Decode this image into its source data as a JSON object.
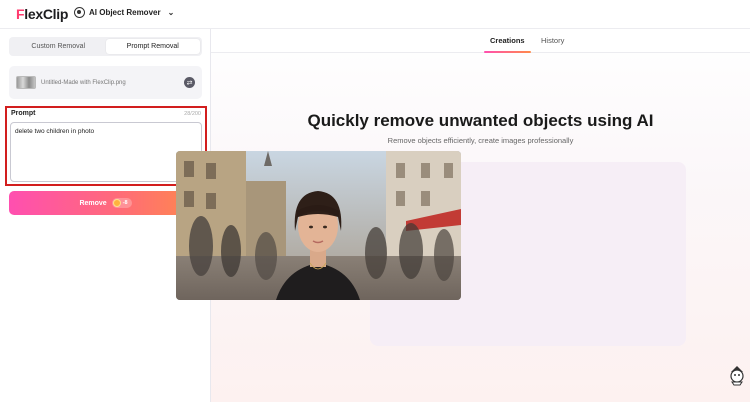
{
  "app": {
    "logo_prefix": "F",
    "logo_rest": "lexClip",
    "tool_name": "AI Object Remover",
    "tool_icon": "object-remover-icon",
    "chevron_icon": "chevron-down-icon"
  },
  "left_panel": {
    "mode_tabs": [
      {
        "label": "Custom Removal",
        "active": false
      },
      {
        "label": "Prompt Removal",
        "active": true
      }
    ],
    "file": {
      "name": "Untitled-Made with FlexClip.png",
      "thumb_icon": "image-thumbnail",
      "swap_icon": "swap-icon"
    },
    "prompt": {
      "label": "Prompt",
      "count": "28/200",
      "value": "delete two children in photo"
    },
    "remove_button": {
      "label": "Remove",
      "credits": "-8",
      "coin_icon": "coin-icon"
    }
  },
  "main": {
    "tabs": [
      {
        "label": "Creations",
        "active": true
      },
      {
        "label": "History",
        "active": false
      }
    ],
    "title": "Quickly remove unwanted objects using AI",
    "subtitle": "Remove objects efficiently, create images professionally",
    "sample_image": "woman-in-street-photo"
  },
  "colors": {
    "accent_start": "#ff4fb0",
    "accent_end": "#ff8a4a",
    "highlight_border": "#d21e1e"
  }
}
